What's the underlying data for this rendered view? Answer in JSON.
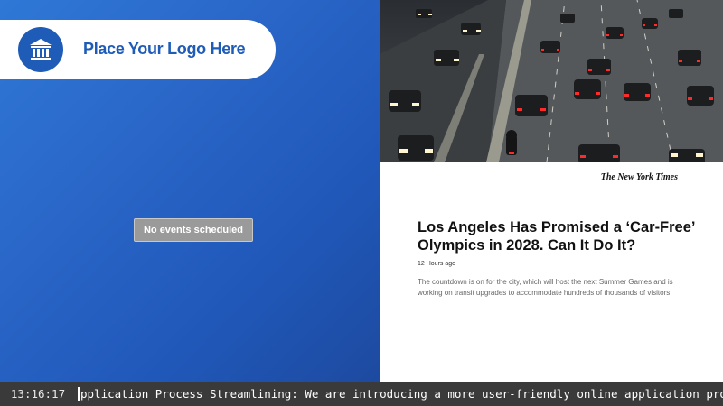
{
  "branding": {
    "logo_text": "Place Your Logo Here",
    "logo_icon": "bank-building-icon",
    "accent_color": "#1f5cb8"
  },
  "events": {
    "empty_message": "No events scheduled"
  },
  "news": {
    "photo_alt": "Freeway traffic at night",
    "source": "The New York Times",
    "headline": "Los Angeles Has Promised a ‘Car-Free’ Olympics in 2028. Can It Do It?",
    "time_ago": "12 Hours ago",
    "summary": "The countdown is on for the city, which will host the next Summer Games and is working on transit upgrades to accommodate hundreds of thousands of visitors."
  },
  "ticker": {
    "clock": "13:16:17",
    "text": "pplication Process Streamlining: We are introducing a more user-friendly online application process to make it easier fo"
  }
}
